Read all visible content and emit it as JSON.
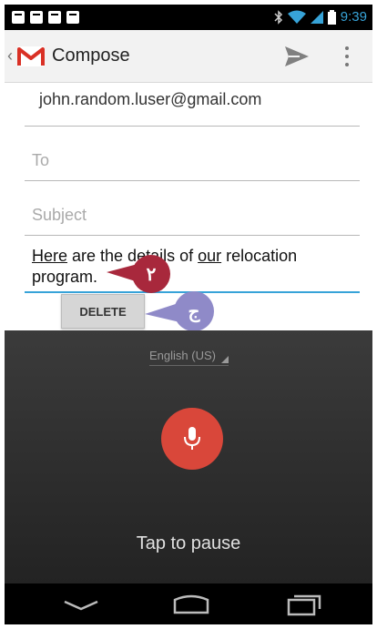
{
  "status_bar": {
    "time": "9:39",
    "notification_icons": [
      "notification-icon",
      "notification-icon",
      "notification-icon",
      "notification-icon"
    ],
    "status_icons": [
      "bluetooth-icon",
      "wifi-icon",
      "signal-icon",
      "battery-icon"
    ]
  },
  "action_bar": {
    "title": "Compose",
    "app_icon": "gmail-icon",
    "send_icon": "send-icon",
    "overflow_icon": "overflow-menu-icon"
  },
  "compose": {
    "from": "john.random.luser@gmail.com",
    "to_placeholder": "To",
    "subject_placeholder": "Subject",
    "body": {
      "part1": "Here",
      "part2": " are the details of ",
      "part3": "our",
      "part4": " relocation",
      "part5": "program."
    },
    "delete_label": "DELETE"
  },
  "callouts": {
    "first": "٢",
    "second": "ج"
  },
  "voice": {
    "language": "English (US)",
    "mic_icon": "microphone-icon",
    "status": "Tap to pause"
  },
  "nav_bar": {
    "back_icon": "back-icon",
    "home_icon": "home-icon",
    "recents_icon": "recents-icon"
  },
  "colors": {
    "accent": "#37a3d8",
    "mic": "#d9473a",
    "callout_red": "#a8283c",
    "callout_purple": "#8f8ac8"
  }
}
